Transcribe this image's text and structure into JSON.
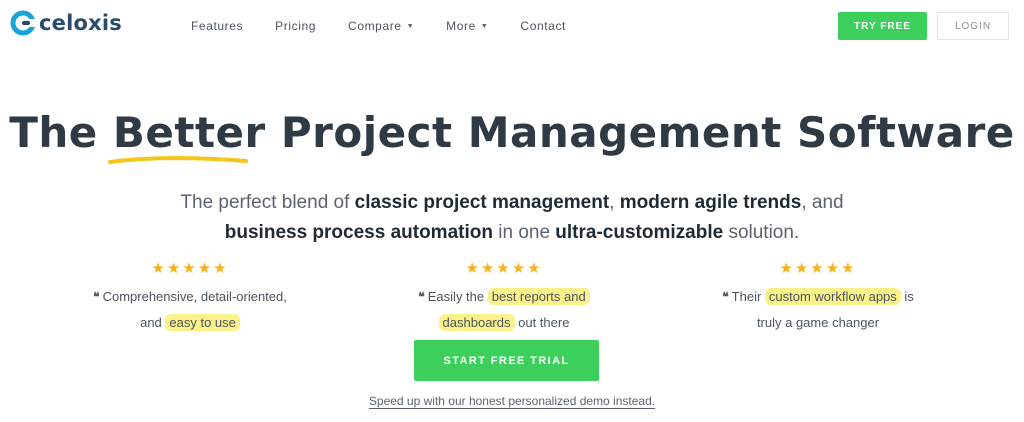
{
  "brand": {
    "name": "celoxis",
    "logo_color": "#2b4a6d",
    "accent_color": "#1aa3d9"
  },
  "nav": {
    "items": [
      {
        "label": "Features",
        "has_caret": false
      },
      {
        "label": "Pricing",
        "has_caret": false
      },
      {
        "label": "Compare",
        "has_caret": true
      },
      {
        "label": "More",
        "has_caret": true
      },
      {
        "label": "Contact",
        "has_caret": false
      }
    ],
    "try_free": "TRY FREE",
    "login": "LOGIN"
  },
  "hero": {
    "title_pre": "The ",
    "title_emphasis": "Better",
    "title_post": " Project Management Software",
    "underline_color": "#f5c518",
    "subtitle_parts": [
      {
        "text": "The perfect blend of ",
        "bold": false
      },
      {
        "text": "classic project management",
        "bold": true
      },
      {
        "text": ", ",
        "bold": false
      },
      {
        "text": "modern agile trends",
        "bold": true
      },
      {
        "text": ", and ",
        "bold": false
      },
      {
        "text": "business process automation",
        "bold": true
      },
      {
        "text": " in one ",
        "bold": false
      },
      {
        "text": "ultra-customizable",
        "bold": true
      },
      {
        "text": " solution.",
        "bold": false
      }
    ]
  },
  "reviews": [
    {
      "rating": 5,
      "stars": "★★★★★",
      "quote_icon": "quote-icon",
      "line1_parts": [
        {
          "text": "Comprehensive, detail-oriented,",
          "highlight": false
        }
      ],
      "line2_parts": [
        {
          "text": "and ",
          "highlight": false
        },
        {
          "text": "easy to use",
          "highlight": true
        }
      ]
    },
    {
      "rating": 5,
      "stars": "★★★★★",
      "quote_icon": "quote-icon",
      "line1_parts": [
        {
          "text": "Easily the ",
          "highlight": false
        },
        {
          "text": "best reports and",
          "highlight": true
        }
      ],
      "line2_parts": [
        {
          "text": "dashboards",
          "highlight": true
        },
        {
          "text": " out there",
          "highlight": false
        }
      ]
    },
    {
      "rating": 5,
      "stars": "★★★★★",
      "quote_icon": "quote-icon",
      "line1_parts": [
        {
          "text": "Their ",
          "highlight": false
        },
        {
          "text": "custom workflow apps",
          "highlight": true
        },
        {
          "text": " is",
          "highlight": false
        }
      ],
      "line2_parts": [
        {
          "text": "truly a game changer",
          "highlight": false
        }
      ]
    }
  ],
  "cta": {
    "trial_label": "START FREE TRIAL",
    "demo_link": "Speed up with our honest personalized demo instead.",
    "button_color": "#3ccf5c",
    "highlight_color": "#fbf18a",
    "star_color": "#f7b21b"
  }
}
